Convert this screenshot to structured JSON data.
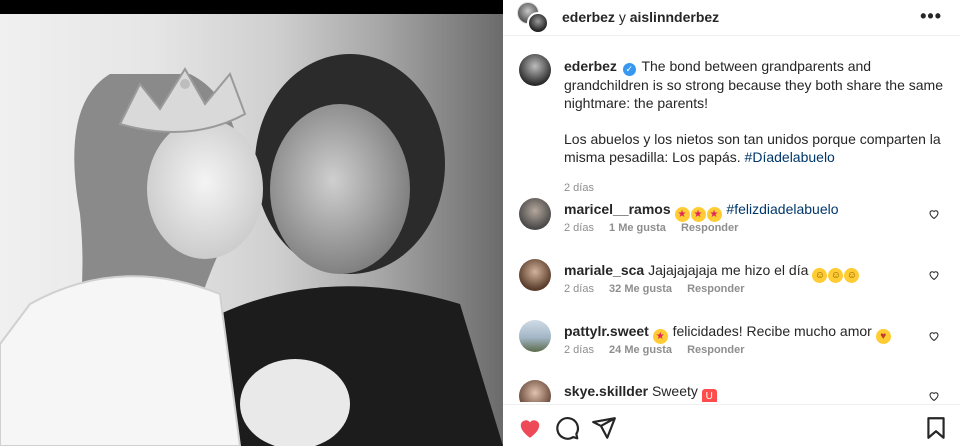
{
  "header": {
    "user1": "ederbez",
    "joiner": "y",
    "user2": "aislinnderbez",
    "more_label": "•••"
  },
  "caption": {
    "username": "ederbez",
    "verified_mark": "✓",
    "text_en": "The bond between grandparents and grandchildren is so strong because they both share the same nightmare: the parents!",
    "text_es": "Los abuelos y los nietos son tan unidos porque comparten la misma pesadilla: Los papás.",
    "hashtag": "#Díadelabuelo",
    "time": "2 días"
  },
  "comments": [
    {
      "username": "maricel__ramos",
      "emojis": [
        "🤩",
        "🤩",
        "🤩"
      ],
      "text": "",
      "hashtag": "#felizdiadelabuelo",
      "time": "2 días",
      "likes": "1 Me gusta",
      "reply": "Responder",
      "avatar_color": "#6b6b6b"
    },
    {
      "username": "mariale_sca",
      "text": "Jajajajajaja me hizo el día",
      "emojis_after": [
        "🤣",
        "🤣",
        "🤣"
      ],
      "time": "2 días",
      "likes": "32 Me gusta",
      "reply": "Responder",
      "avatar_color": "#7a5a48"
    },
    {
      "username": "pattylr.sweet",
      "emoji_before": "🤩",
      "text": "felicidades! Recibe mucho amor",
      "emoji_after": "🥰",
      "time": "2 días",
      "likes": "24 Me gusta",
      "reply": "Responder",
      "avatar_color": "#8aa0b4"
    },
    {
      "username": "skye.skillder",
      "text": "Sweety",
      "emoji_after": "👅",
      "avatar_color": "#9c7a6a"
    }
  ],
  "actions": {
    "like_icon": "heart-icon-filled",
    "comment_icon": "comment-icon",
    "share_icon": "share-icon",
    "save_icon": "bookmark-icon"
  },
  "colors": {
    "like_red": "#ed4956",
    "link_blue": "#00376b",
    "verified_blue": "#3897f0",
    "meta_gray": "#8e8e8e"
  }
}
